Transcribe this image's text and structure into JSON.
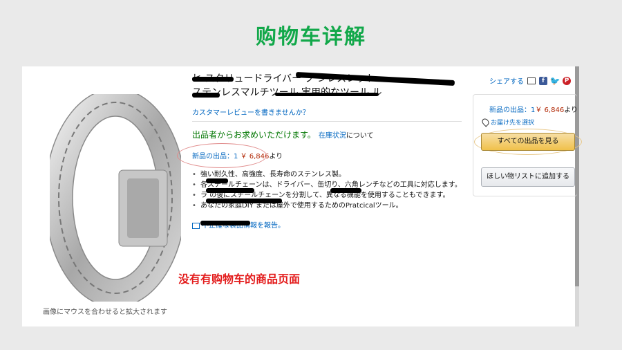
{
  "slide": {
    "title": "购物车详解",
    "annotation": "没有有购物车的商品页面"
  },
  "product": {
    "title_line1": "ヒ     スクリュードライバー プ            ンレスレット",
    "title_line2": "ステンレスマルチツール 実用的なツール ル",
    "review_link": "カスタマーレビューを書きませんか？",
    "availability": "出品者からお求めいただけます。",
    "stock_link": "在庫状況",
    "about": "について",
    "new_item_label": "新品の出品：1",
    "new_item_price": "￥ 6,846",
    "new_item_suffix": "より",
    "bullets": [
      "強い耐久性、高強度、長寿命のステンレス製。",
      "各スチールチェーンは、ドライバー、缶切り、六角レンチなどの工具に対応します。",
      "ラ                     の後にスチールチェーンを分割して、異なる機能を使用することもできます。",
      "あなたの家庭DIY または屋外で使用するためのPratcicalツール。"
    ],
    "report_link": "不正確な製品情報を報告。",
    "zoom_hint": "画像にマウスを合わせると拡大されます"
  },
  "share": {
    "label": "シェアする",
    "icons": [
      "mail-icon",
      "facebook-icon",
      "twitter-icon",
      "pinterest-icon"
    ]
  },
  "buybox": {
    "price_label": "新品の出品：1",
    "price": "￥ 6,846",
    "price_suffix": "より",
    "deliver_to": "お届け先を選択",
    "all_offers_button": "すべての出品を見る",
    "wishlist_button": "ほしい物リストに追加する"
  },
  "colors": {
    "title_green": "#12a84a",
    "annotation_red": "#e31b1b",
    "link_blue": "#0066c0",
    "price_red": "#b12704",
    "availability_green": "#007600",
    "button_yellow": "#f0c14b"
  }
}
